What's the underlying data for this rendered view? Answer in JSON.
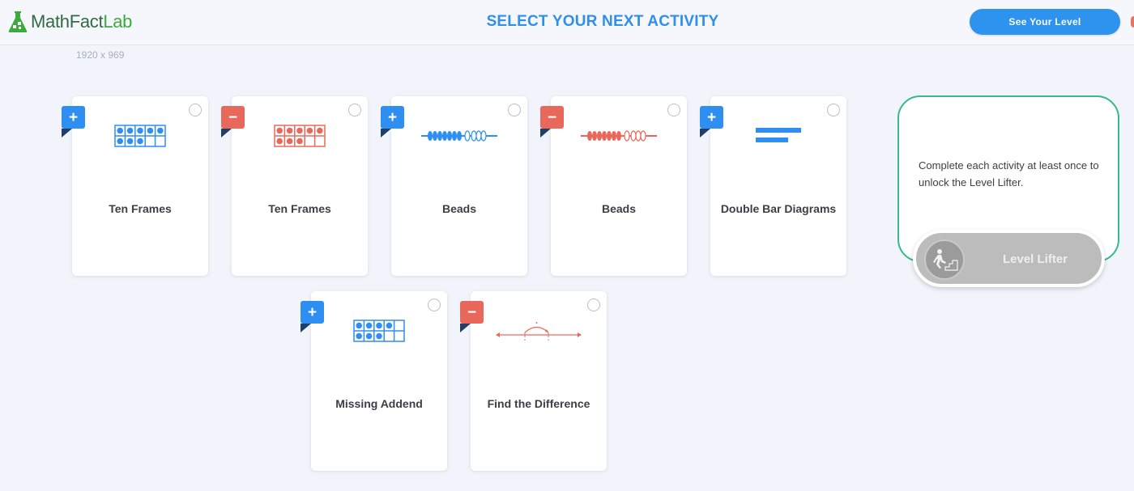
{
  "header": {
    "logo_math": "Math",
    "logo_fact": "Fact",
    "logo_lab": "Lab",
    "title": "SELECT YOUR NEXT ACTIVITY",
    "see_level_label": "See Your Level",
    "resolution": "1920 x 969"
  },
  "activities": [
    {
      "op": "+",
      "label": "Ten Frames",
      "icon": "ten-frame-icon",
      "color": "#2e8ff0"
    },
    {
      "op": "−",
      "label": "Ten Frames",
      "icon": "ten-frame-icon",
      "color": "#e8695c"
    },
    {
      "op": "+",
      "label": "Beads",
      "icon": "beads-icon",
      "color": "#2e8ff0"
    },
    {
      "op": "−",
      "label": "Beads",
      "icon": "beads-icon",
      "color": "#e8695c"
    },
    {
      "op": "+",
      "label": "Double Bar Diagrams",
      "icon": "double-bar-icon",
      "color": "#2e8ff0"
    },
    {
      "op": "+",
      "label": "Missing Addend",
      "icon": "ten-frame-icon",
      "color": "#2e8ff0"
    },
    {
      "op": "−",
      "label": "Find the Difference",
      "icon": "number-line-icon",
      "color": "#e8695c"
    }
  ],
  "unlock": {
    "text": "Complete each activity at least once to unlock the Level Lifter.",
    "button_label": "Level Lifter",
    "button_icon": "stair-climber-icon"
  },
  "colors": {
    "accent_blue": "#2e8ff0",
    "accent_red": "#e8695c",
    "panel_border": "#37b88f"
  }
}
